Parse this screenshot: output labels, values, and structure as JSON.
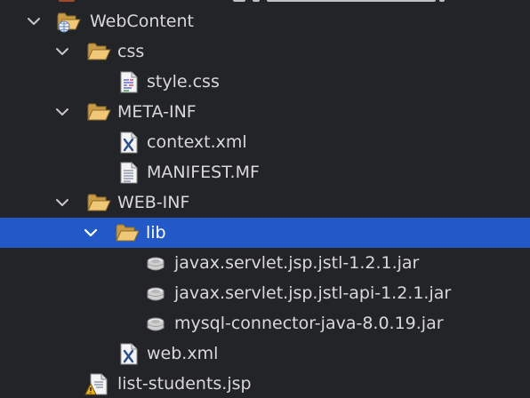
{
  "tree": {
    "items": [
      {
        "label": "WebContent",
        "icon": "web-project-folder-icon",
        "expanded": true
      },
      {
        "label": "css",
        "icon": "folder-open-icon",
        "expanded": true
      },
      {
        "label": "style.css",
        "icon": "css-file-icon"
      },
      {
        "label": "META-INF",
        "icon": "folder-open-icon",
        "expanded": true
      },
      {
        "label": "context.xml",
        "icon": "xml-file-icon"
      },
      {
        "label": "MANIFEST.MF",
        "icon": "text-file-icon"
      },
      {
        "label": "WEB-INF",
        "icon": "folder-open-icon",
        "expanded": true
      },
      {
        "label": "lib",
        "icon": "folder-open-icon",
        "expanded": true,
        "selected": true
      },
      {
        "label": "javax.servlet.jsp.jstl-1.2.1.jar",
        "icon": "jar-file-icon"
      },
      {
        "label": "javax.servlet.jsp.jstl-api-1.2.1.jar",
        "icon": "jar-file-icon"
      },
      {
        "label": "mysql-connector-java-8.0.19.jar",
        "icon": "jar-file-icon"
      },
      {
        "label": "web.xml",
        "icon": "xml-file-icon"
      },
      {
        "label": "list-students.jsp",
        "icon": "jsp-file-warning-icon"
      }
    ]
  },
  "colors": {
    "background": "#232427",
    "selection": "#2259c6",
    "text": "#d9d9db",
    "selected_text": "#ffffff",
    "folder": "#e9b760",
    "warning": "#e6b422"
  }
}
